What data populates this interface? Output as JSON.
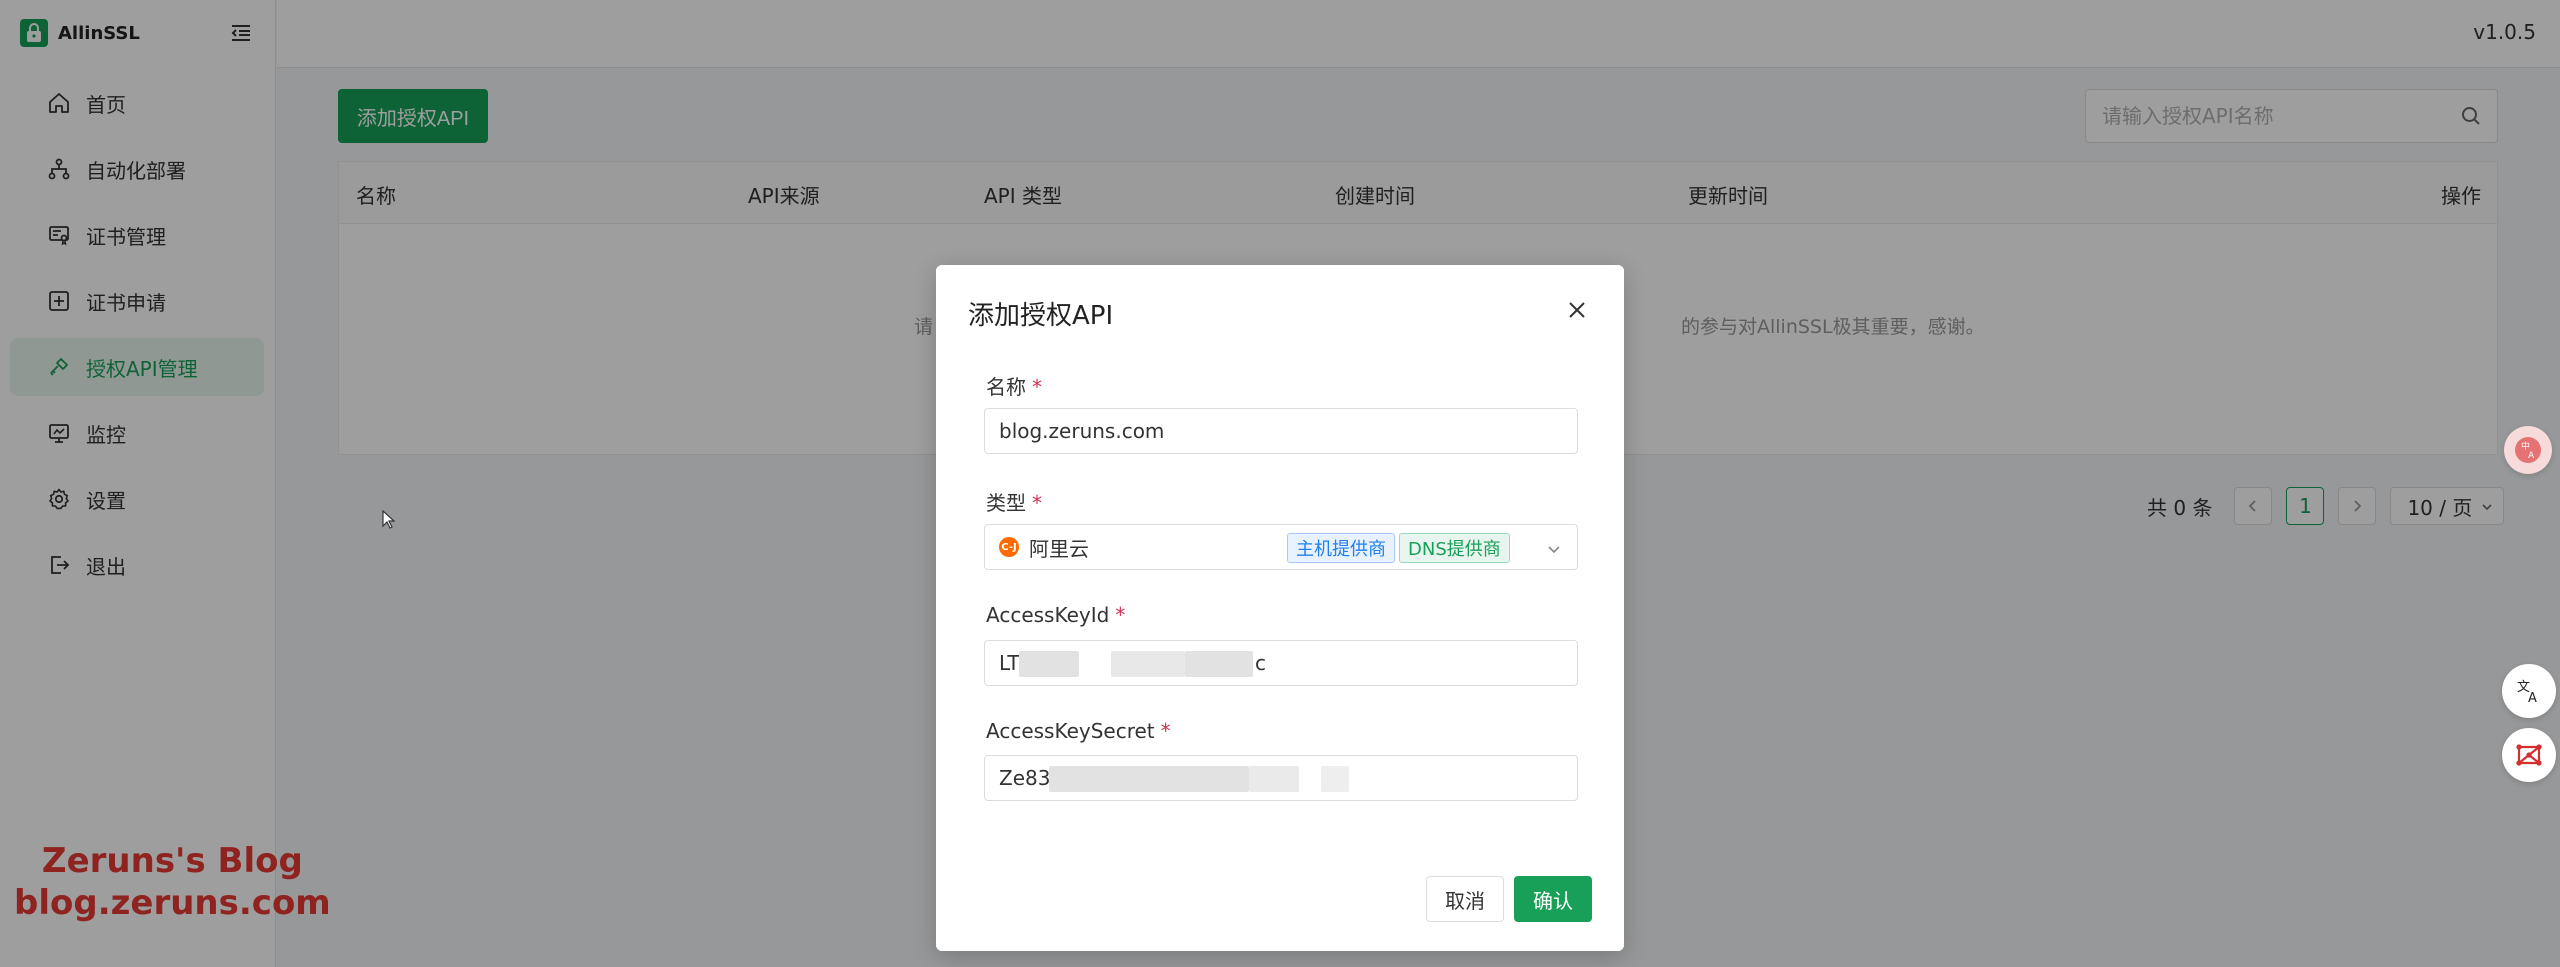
{
  "app": {
    "name": "AllinSSL",
    "version": "v1.0.5"
  },
  "sidebar": {
    "items": [
      {
        "label": "首页",
        "icon": "home-icon"
      },
      {
        "label": "自动化部署",
        "icon": "workflow-icon"
      },
      {
        "label": "证书管理",
        "icon": "certificate-icon"
      },
      {
        "label": "证书申请",
        "icon": "add-square-icon"
      },
      {
        "label": "授权API管理",
        "icon": "api-key-icon",
        "active": true
      },
      {
        "label": "监控",
        "icon": "monitor-icon"
      },
      {
        "label": "设置",
        "icon": "gear-icon"
      },
      {
        "label": "退出",
        "icon": "logout-icon"
      }
    ]
  },
  "toolbar": {
    "add_label": "添加授权API",
    "search_placeholder": "请输入授权API名称"
  },
  "table": {
    "columns": [
      "名称",
      "API来源",
      "API 类型",
      "创建时间",
      "更新时间",
      "操作"
    ],
    "empty_left": "请",
    "empty_right": "的参与对AllinSSL极其重要，感谢。"
  },
  "pagination": {
    "total": "共 0 条",
    "current_page": "1",
    "page_size": "10 / 页"
  },
  "modal": {
    "title": "添加授权API",
    "fields": {
      "name": {
        "label": "名称",
        "value": "blog.zeruns.com"
      },
      "type": {
        "label": "类型",
        "value": "阿里云",
        "tags": [
          "主机提供商",
          "DNS提供商"
        ]
      },
      "access_key_id": {
        "label": "AccessKeyId",
        "value_start": "LT",
        "value_end": "c"
      },
      "access_key_secret": {
        "label": "AccessKeySecret",
        "value_start": "Ze83"
      }
    },
    "cancel_label": "取消",
    "confirm_label": "确认"
  },
  "watermark": {
    "line1": "Zeruns's Blog",
    "line2": "blog.zeruns.com"
  },
  "colors": {
    "primary": "#18a058",
    "host_tag": "#2080f0",
    "required": "#d03050"
  }
}
